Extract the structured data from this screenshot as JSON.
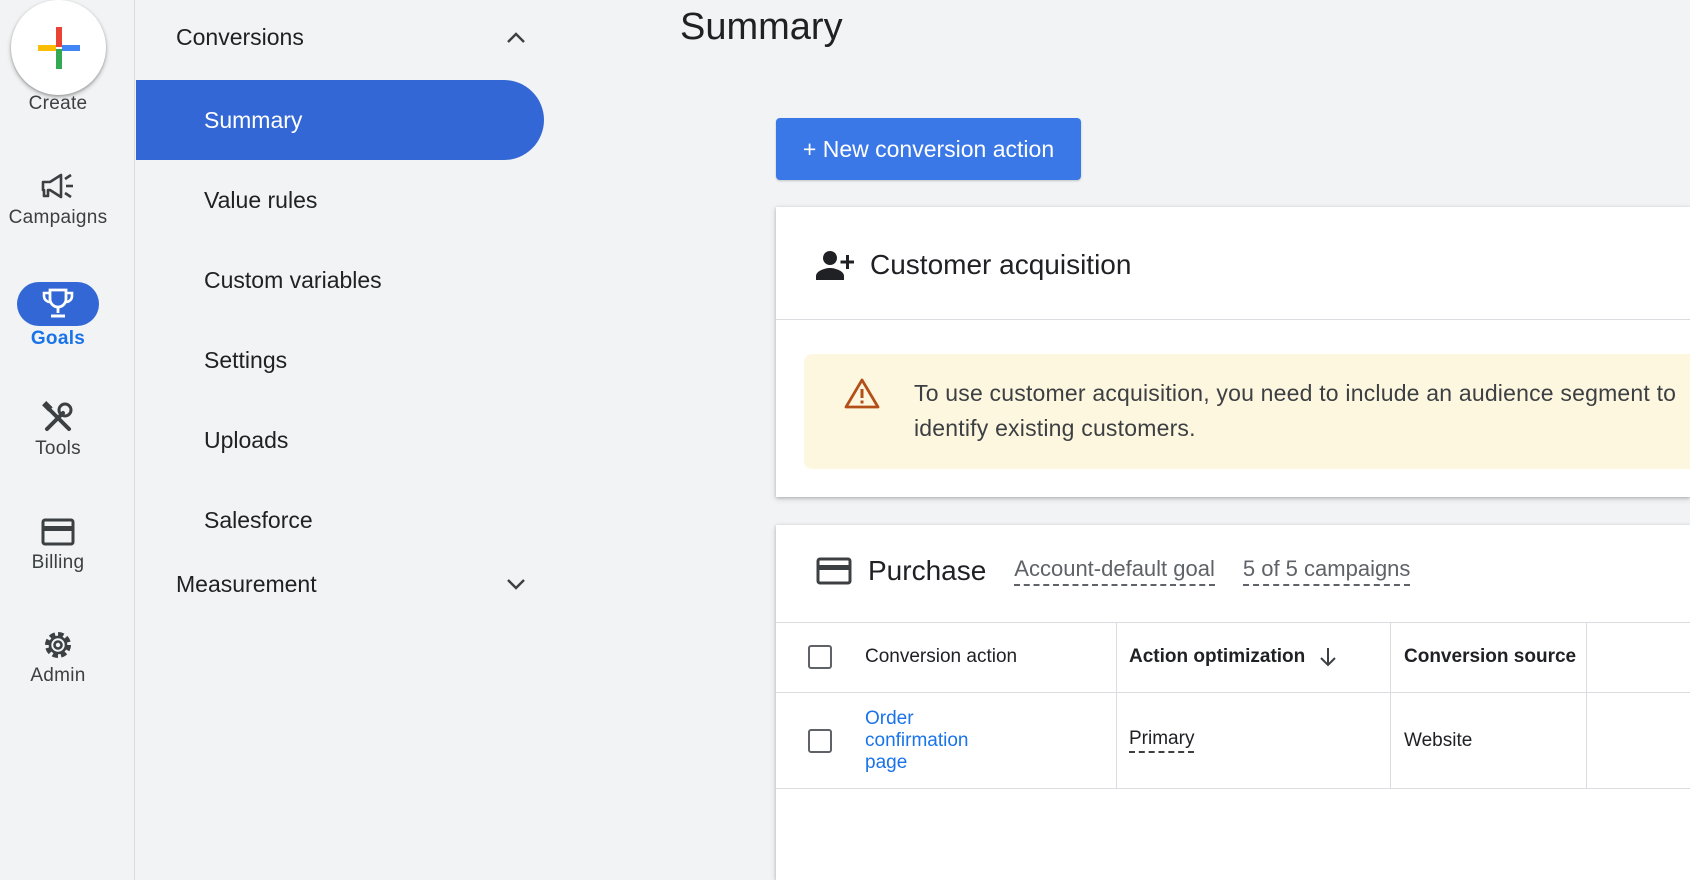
{
  "rail": {
    "create_label": "Create",
    "items": [
      {
        "label": "Campaigns",
        "icon": "megaphone-icon"
      },
      {
        "label": "Goals",
        "icon": "trophy-icon",
        "active": true
      },
      {
        "label": "Tools",
        "icon": "tools-icon"
      },
      {
        "label": "Billing",
        "icon": "credit-card-icon"
      },
      {
        "label": "Admin",
        "icon": "gear-icon"
      }
    ]
  },
  "subnav": {
    "conversions_header": "Conversions",
    "items": [
      {
        "label": "Summary",
        "active": true
      },
      {
        "label": "Value rules"
      },
      {
        "label": "Custom variables"
      },
      {
        "label": "Settings"
      },
      {
        "label": "Uploads"
      },
      {
        "label": "Salesforce"
      }
    ],
    "measurement_header": "Measurement"
  },
  "main": {
    "title": "Summary",
    "new_button": "+ New conversion action",
    "customer_acquisition": {
      "title": "Customer acquisition",
      "warning": "To use customer acquisition, you need to include an audience segment to identify existing customers."
    },
    "purchase": {
      "title": "Purchase",
      "goal_type": "Account-default goal",
      "campaigns": "5 of 5 campaigns",
      "table": {
        "headers": [
          "Conversion action",
          "Action optimization",
          "Conversion source"
        ],
        "rows": [
          {
            "action": "Order confirmation page",
            "optimization": "Primary",
            "source": "Website"
          }
        ]
      }
    }
  },
  "colors": {
    "accent": "#3367d6",
    "button": "#3b78e7",
    "link": "#1a73e8",
    "warning_bg": "#fef7e0",
    "warning_icon": "#b3501a"
  }
}
